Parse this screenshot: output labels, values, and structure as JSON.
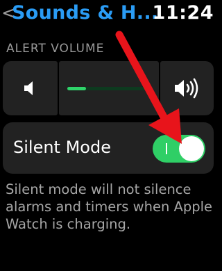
{
  "header": {
    "back_glyph": "<",
    "title": "Sounds & H...",
    "time": "11:24"
  },
  "alert_volume": {
    "label": "ALERT VOLUME",
    "level": 0.23,
    "decrease_icon": "speaker-low-icon",
    "increase_icon": "speaker-high-icon"
  },
  "silent_mode": {
    "label": "Silent Mode",
    "enabled": true
  },
  "description": "Silent mode will not silence alarms and timers when Apple Watch is charging.",
  "colors": {
    "title": "#2a9cf5",
    "toggle_on": "#2fcf66",
    "slider_fill": "#2fd46a",
    "annotation_arrow": "#e8141b"
  }
}
